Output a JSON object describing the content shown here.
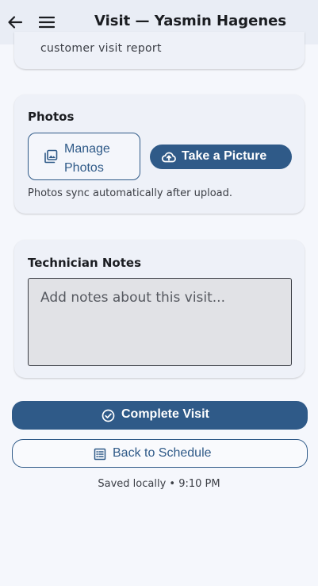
{
  "header": {
    "title": "Visit — Yasmin Hagenes",
    "back_icon": "arrow-left-icon",
    "menu_icon": "hamburger-menu-icon"
  },
  "report_card": {
    "text": "customer visit report"
  },
  "photos_card": {
    "heading": "Photos",
    "manage_label": "Manage Photos",
    "manage_icon": "photo-library-icon",
    "take_label": "Take a Picture",
    "take_icon": "cloud-upload-icon",
    "hint": "Photos sync automatically after upload."
  },
  "notes_card": {
    "heading": "Technician Notes",
    "value": "",
    "placeholder": "Add notes about this visit..."
  },
  "actions": {
    "complete_label": "Complete Visit",
    "complete_icon": "check-circle-icon",
    "back_label": "Back to Schedule",
    "back_icon": "list-icon"
  },
  "status": {
    "saved_text": "Saved locally • 9:10 PM"
  },
  "colors": {
    "primary": "#2f5a88",
    "appbar": "#e9edf5",
    "card": "#eef1f8",
    "background": "#f5f7fc"
  }
}
